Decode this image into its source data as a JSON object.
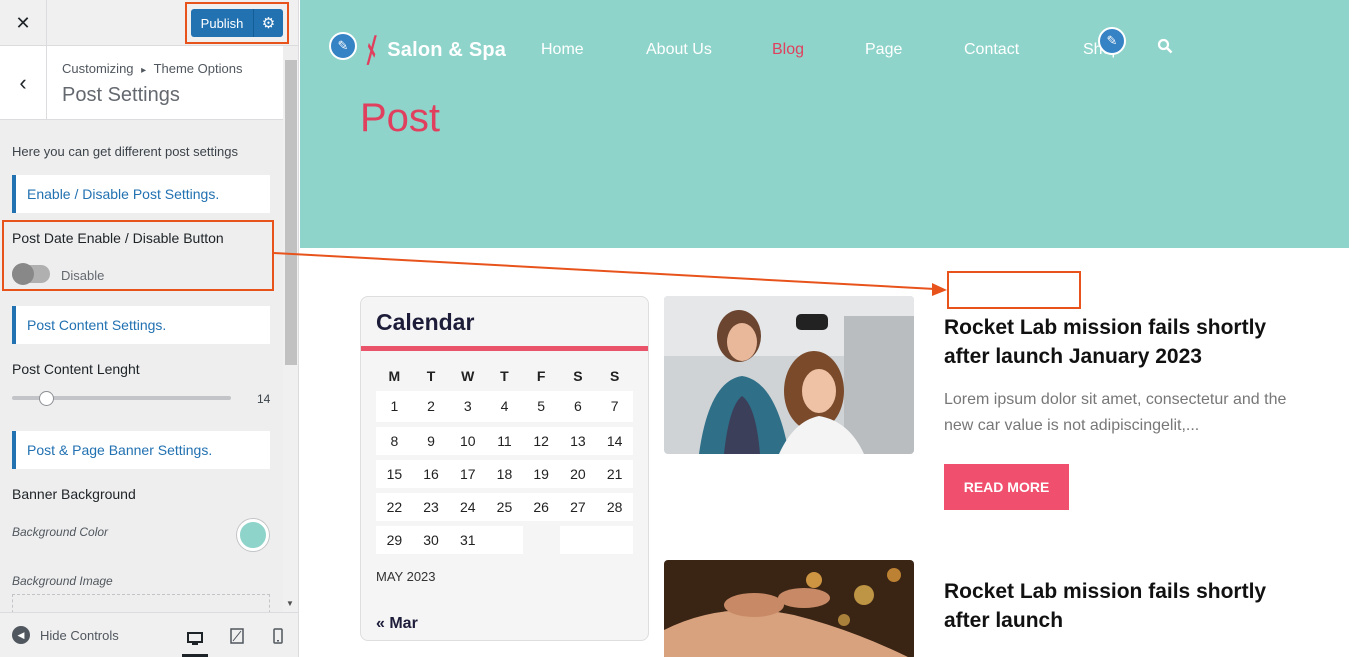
{
  "sidebar": {
    "close_icon": "close-icon",
    "publish_label": "Publish",
    "publish_settings_icon": "gear-icon",
    "breadcrumb_root": "Customizing",
    "breadcrumb_sep": "▸",
    "breadcrumb_parent": "Theme Options",
    "section_title": "Post Settings",
    "description": "Here you can get different post settings",
    "enable_disable_heading": "Enable / Disable Post Settings.",
    "post_date_label": "Post Date Enable / Disable Button",
    "post_date_toggle_state": "Disable",
    "post_content_heading": "Post Content Settings.",
    "post_content_length_label": "Post Content Lenght",
    "post_content_length_value": "14",
    "banner_heading": "Post & Page Banner Settings.",
    "banner_background_label": "Banner Background",
    "background_color_label": "Background Color",
    "background_color_value": "#8ed4ca",
    "background_image_label": "Background Image",
    "hide_controls_label": "Hide Controls"
  },
  "preview": {
    "logo_text": "Salon & Spa",
    "nav": [
      "Home",
      "About Us",
      "Blog",
      "Page",
      "Contact",
      "Shop"
    ],
    "active_nav": "Blog",
    "page_heading": "Post",
    "calendar": {
      "title": "Calendar",
      "weekdays": [
        "M",
        "T",
        "W",
        "T",
        "F",
        "S",
        "S"
      ],
      "weeks": [
        [
          "1",
          "2",
          "3",
          "4",
          "5",
          "6",
          "7"
        ],
        [
          "8",
          "9",
          "10",
          "11",
          "12",
          "13",
          "14"
        ],
        [
          "15",
          "16",
          "17",
          "18",
          "19",
          "20",
          "21"
        ],
        [
          "22",
          "23",
          "24",
          "25",
          "26",
          "27",
          "28"
        ],
        [
          "29",
          "30",
          "31",
          "",
          "",
          "",
          ""
        ]
      ],
      "caption": "MAY 2023",
      "prev_link": "« Mar"
    },
    "posts": [
      {
        "title": "Rocket Lab mission fails shortly after launch January 2023",
        "excerpt": "Lorem ipsum dolor sit amet, consectetur and the new car value is not adipiscingelit,...",
        "button": "READ MORE"
      },
      {
        "title": "Rocket Lab mission fails shortly after launch"
      }
    ]
  },
  "colors": {
    "accent": "#e0405e",
    "hero_bg": "#8ed4ca",
    "publish_blue": "#2271b1",
    "annotation": "#e8531c"
  }
}
